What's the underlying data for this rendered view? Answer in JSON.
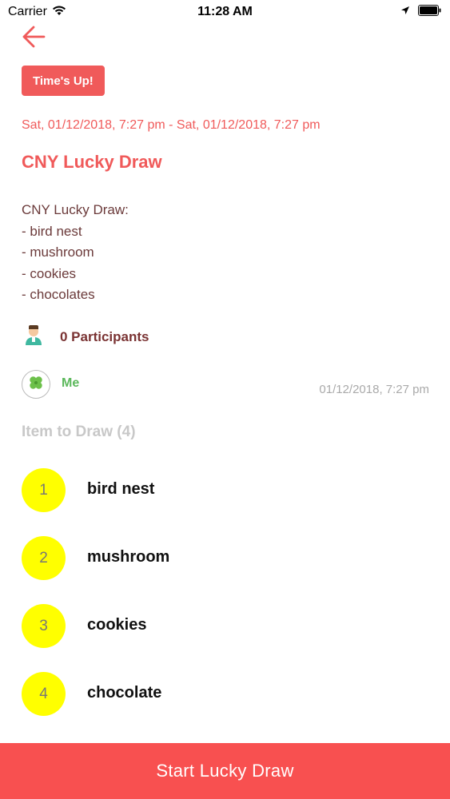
{
  "status_bar": {
    "carrier": "Carrier",
    "time": "11:28 AM"
  },
  "header": {
    "back_icon": "arrow-left-icon"
  },
  "event": {
    "status_badge": "Time's Up!",
    "date_range": "Sat, 01/12/2018, 7:27 pm - Sat, 01/12/2018, 7:27 pm",
    "title": "CNY Lucky Draw",
    "description_lines": [
      "CNY Lucky Draw:",
      "- bird nest",
      "- mushroom",
      "- cookies",
      "- chocolates"
    ],
    "participants_label": "0 Participants"
  },
  "participant": {
    "name": "Me",
    "joined_time": "01/12/2018, 7:27 pm"
  },
  "items_section": {
    "header": "Item to Draw (4)",
    "items": [
      {
        "number": "1",
        "name": "bird nest"
      },
      {
        "number": "2",
        "name": "mushroom"
      },
      {
        "number": "3",
        "name": "cookies"
      },
      {
        "number": "4",
        "name": "chocolate"
      }
    ]
  },
  "footer": {
    "start_button_label": "Start Lucky Draw"
  },
  "colors": {
    "accent": "#f05a5a",
    "item_circle": "#ffff00",
    "me_green": "#5cb85c"
  }
}
